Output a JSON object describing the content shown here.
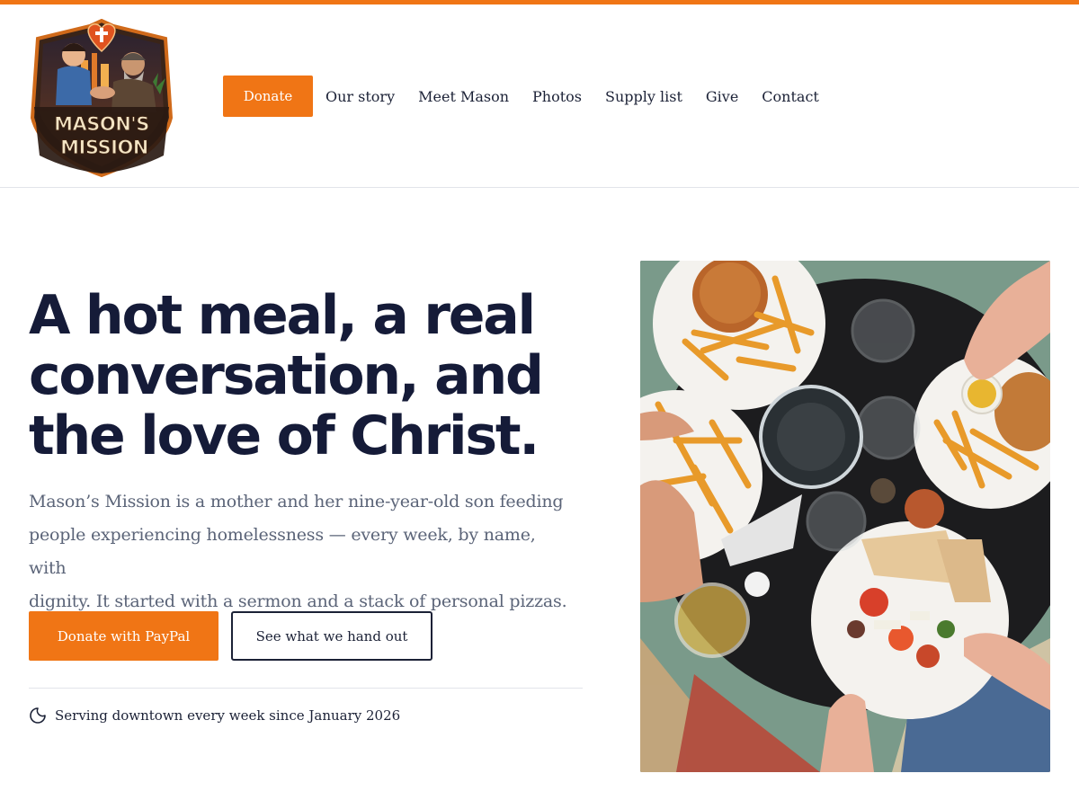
{
  "colors": {
    "accent": "#f07515",
    "navy": "#151b38",
    "muted": "#5b6478"
  },
  "logo": {
    "line1": "MASON'S",
    "line2": "MISSION",
    "alt": "Mason's Mission logo"
  },
  "nav": {
    "donate": "Donate",
    "links": [
      "Our story",
      "Meet Mason",
      "Photos",
      "Supply list",
      "Give",
      "Contact"
    ]
  },
  "hero": {
    "title_lines": [
      "A hot meal, a real",
      "conversation, and",
      "the love of Christ."
    ],
    "subtitle_lines": [
      "Mason’s Mission is a mother and her nine-year-old son feeding",
      "people experiencing homelessness — every week, by name, with",
      "dignity. It started with a sermon and a stack of personal pizzas."
    ],
    "primary_button": "Donate with PayPal",
    "secondary_button": "See what we hand out",
    "serving_icon": "moon-icon",
    "serving_text": "Serving downtown every week since January 2026"
  },
  "photo": {
    "icon": "shared-meal-photo"
  }
}
